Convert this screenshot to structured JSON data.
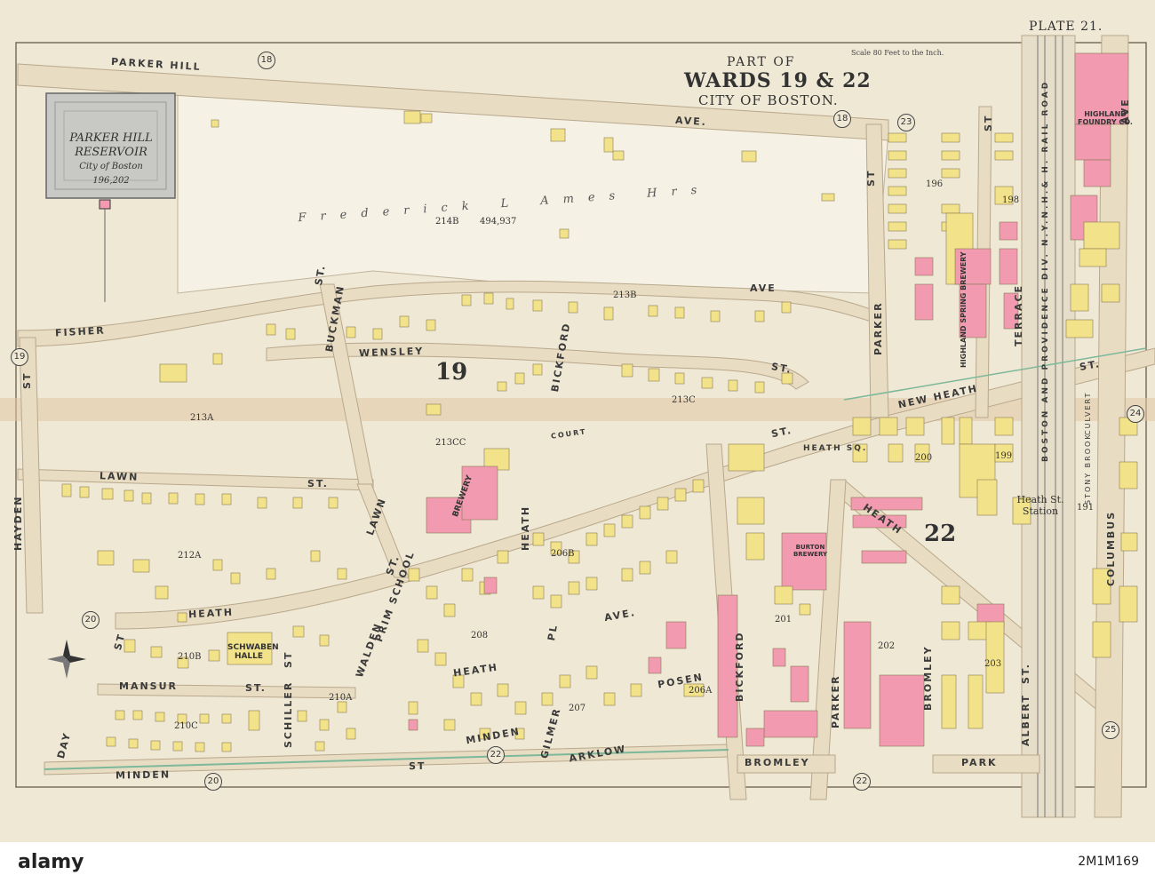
{
  "map": {
    "plate": "PLATE 21.",
    "title_line1": "PART OF",
    "title_line2": "WARDS 19 & 22",
    "title_line3": "CITY OF BOSTON.",
    "scale": "Scale 80 Feet to the Inch.",
    "reservoir": {
      "name1": "PARKER HILL",
      "name2": "RESERVOIR",
      "owner": "City of Boston",
      "area": "196,202"
    },
    "estate": "Frederick L Ames Hrs",
    "estate_area": "494,937",
    "wards": [
      "19",
      "22",
      "22"
    ],
    "sheets": [
      "18",
      "18",
      "19",
      "20",
      "20",
      "22",
      "22",
      "23",
      "24",
      "25"
    ],
    "lots": [
      "214B",
      "213A",
      "213B",
      "213C",
      "213CC",
      "212A",
      "210B",
      "210A",
      "210C",
      "206B",
      "206A",
      "208",
      "200",
      "199",
      "201",
      "202",
      "203",
      "196",
      "198",
      "191",
      "207"
    ],
    "streets": {
      "parker_hill": "PARKER HILL",
      "ave1": "AVE.",
      "ave2": "AVE",
      "fisher": "FISHER",
      "wensley": "WENSLEY",
      "st_wensley": "ST.",
      "buckman": "BUCKMAN",
      "st_buckman": "ST.",
      "lawn1": "LAWN",
      "st_lawn1": "ST.",
      "lawn2": "LAWN",
      "st_lawn2": "ST.",
      "hayden": "HAYDEN",
      "st_hayden": "ST",
      "heath": "HEATH",
      "heath2": "HEATH",
      "heath3": "HEATH",
      "heath4": "HEATH",
      "st_heath": "ST.",
      "heath_ave": "AVE.",
      "new_heath": "NEW HEATH",
      "st_newheath": "ST.",
      "bickford1": "BICKFORD",
      "bickford2": "BICKFORD",
      "parker1": "PARKER",
      "parker2": "PARKER",
      "st_parker": "ST",
      "terrace": "TERRACE",
      "st_terrace": "ST",
      "mansur": "MANSUR",
      "st_mansur": "ST.",
      "schiller": "SCHILLER",
      "st_schiller": "ST",
      "walden": "WALDEN",
      "day": "DAY",
      "st_day": "ST",
      "minden": "MINDEN",
      "st_minden": "ST",
      "minden2": "MINDEN",
      "prim_school": "PRIM SCHOOL",
      "bromley": "BROMLEY",
      "bromley2": "BROMLEY",
      "park": "PARK",
      "albert": "ALBERT",
      "st_albert": "ST.",
      "columbus": "COLUMBUS",
      "ave_columbus": "AVE",
      "pl": "PL",
      "posen": "POSEN",
      "arklow": "ARKLOW",
      "gilmer": "GILMER",
      "court": "COURT",
      "heath_sq": "HEATH SQ.",
      "railroad": "BOSTON AND PROVIDENCE DIV. N.Y.N.H.& H. RAIL ROAD",
      "stony_brook": "STONY BROOK",
      "culvert": "CULVERT"
    },
    "buildings": {
      "brewery": "BREWERY",
      "burton": "BURTON BREWERY",
      "schwaben": "SCHWABEN HALLE",
      "highland_spring": "HIGHLAND SPRING BREWERY",
      "highland_foundry": "HIGHLAND FOUNDRY CO.",
      "heath_station": "Heath St. Station"
    },
    "colors": {
      "paper": "#efe8d5",
      "brick": "#f19ab0",
      "wood": "#f2e38a",
      "park_gray": "#c8c8c4",
      "road_edge": "#b9a88c"
    }
  },
  "watermark": {
    "logo": "alamy",
    "image_id": "2M1M169"
  }
}
